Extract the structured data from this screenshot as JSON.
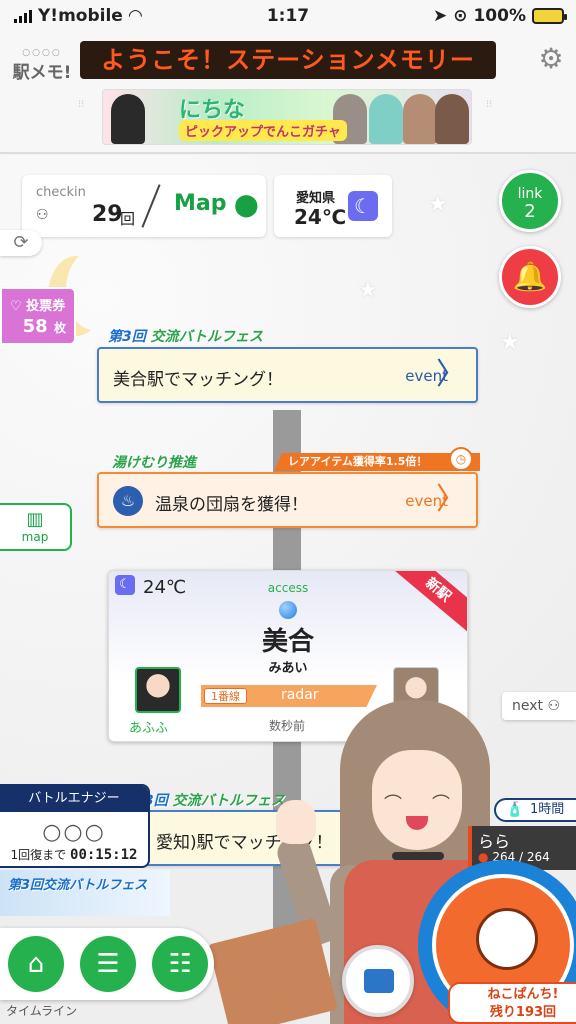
{
  "status": {
    "carrier": "Y!mobile",
    "time": "1:17",
    "battery": "100%"
  },
  "header": {
    "logo": "駅メモ!",
    "marquee": "ようこそ！ステーションメモリー",
    "banner_title": "にちな",
    "banner_sub": "ピックアップでんこガチャ"
  },
  "checkin": {
    "label": "checkin",
    "count": "29",
    "unit": "回",
    "map": "Map"
  },
  "weather": {
    "pref": "愛知県",
    "temp": "24℃"
  },
  "link": {
    "label": "link",
    "count": "2"
  },
  "vote": {
    "label": "♡ 投票券",
    "count": "58",
    "unit": "枚"
  },
  "events": [
    {
      "tag_no": "第3回",
      "tag": "交流バトルフェス",
      "text": "美合駅でマッチング！",
      "kind": "event"
    },
    {
      "tag": "湯けむり推進",
      "banner": "レアアイテム獲得率1.5倍！",
      "text": "温泉の団扇を獲得！",
      "kind": "event"
    },
    {
      "tag_no": "第3回",
      "tag": "交流バトルフェス",
      "text": "愛知)駅でマッチング！"
    }
  ],
  "map_btn": "map",
  "station": {
    "temp": "24℃",
    "access": "access",
    "new_label": "新駅",
    "name": "美合",
    "kana": "みあい",
    "user": "あふふ",
    "line": "1番線",
    "radar": "radar",
    "since": "数秒前"
  },
  "next": "next",
  "energy": {
    "title": "バトルエナジー",
    "circles": "○○○",
    "recover_label": "1回復まで",
    "recover_time": "00:15:12"
  },
  "fest_strip": "第3回交流バトルフェス",
  "time_badge": "1時間",
  "partner": {
    "name": "らら",
    "hp": "264 / 264"
  },
  "punch": {
    "line1": "ねこぱんち!",
    "line2": "残り193回"
  },
  "nav": {
    "timeline": "タイムライン"
  },
  "colors": {
    "green": "#25b14d",
    "orange": "#f07522",
    "blue": "#4b7cc7",
    "red": "#ee3d45"
  }
}
